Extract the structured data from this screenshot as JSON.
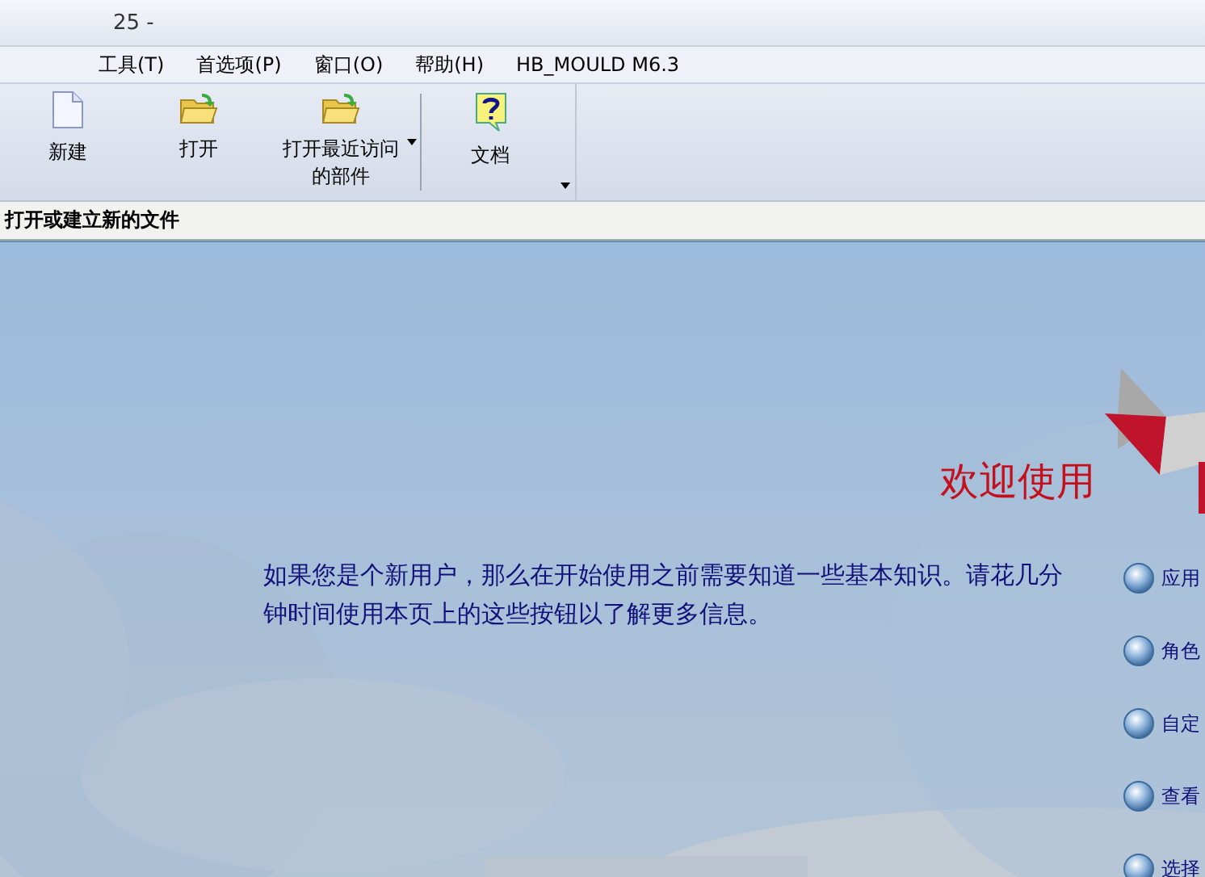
{
  "window": {
    "title": "25 -"
  },
  "menu": [
    "工具(T)",
    "首选项(P)",
    "窗口(O)",
    "帮助(H)",
    "HB_MOULD M6.3"
  ],
  "toolbar": [
    {
      "kind": "new",
      "label": "新建",
      "dropdown": false
    },
    {
      "kind": "open",
      "label": "打开",
      "dropdown": false
    },
    {
      "kind": "open",
      "label": "打开最近访问的部件",
      "dropdown": true
    },
    {
      "kind": "help",
      "label": "文档",
      "dropdown": false
    }
  ],
  "hint": "打开或建立新的文件",
  "welcome": {
    "title": "欢迎使用",
    "intro": "如果您是个新用户，那么在开始使用之前需要知道一些基本知识。请花几分钟时间使用本页上的这些按钮以了解更多信息。",
    "links": [
      "应用",
      "角色",
      "自定",
      "查看",
      "选择"
    ]
  }
}
